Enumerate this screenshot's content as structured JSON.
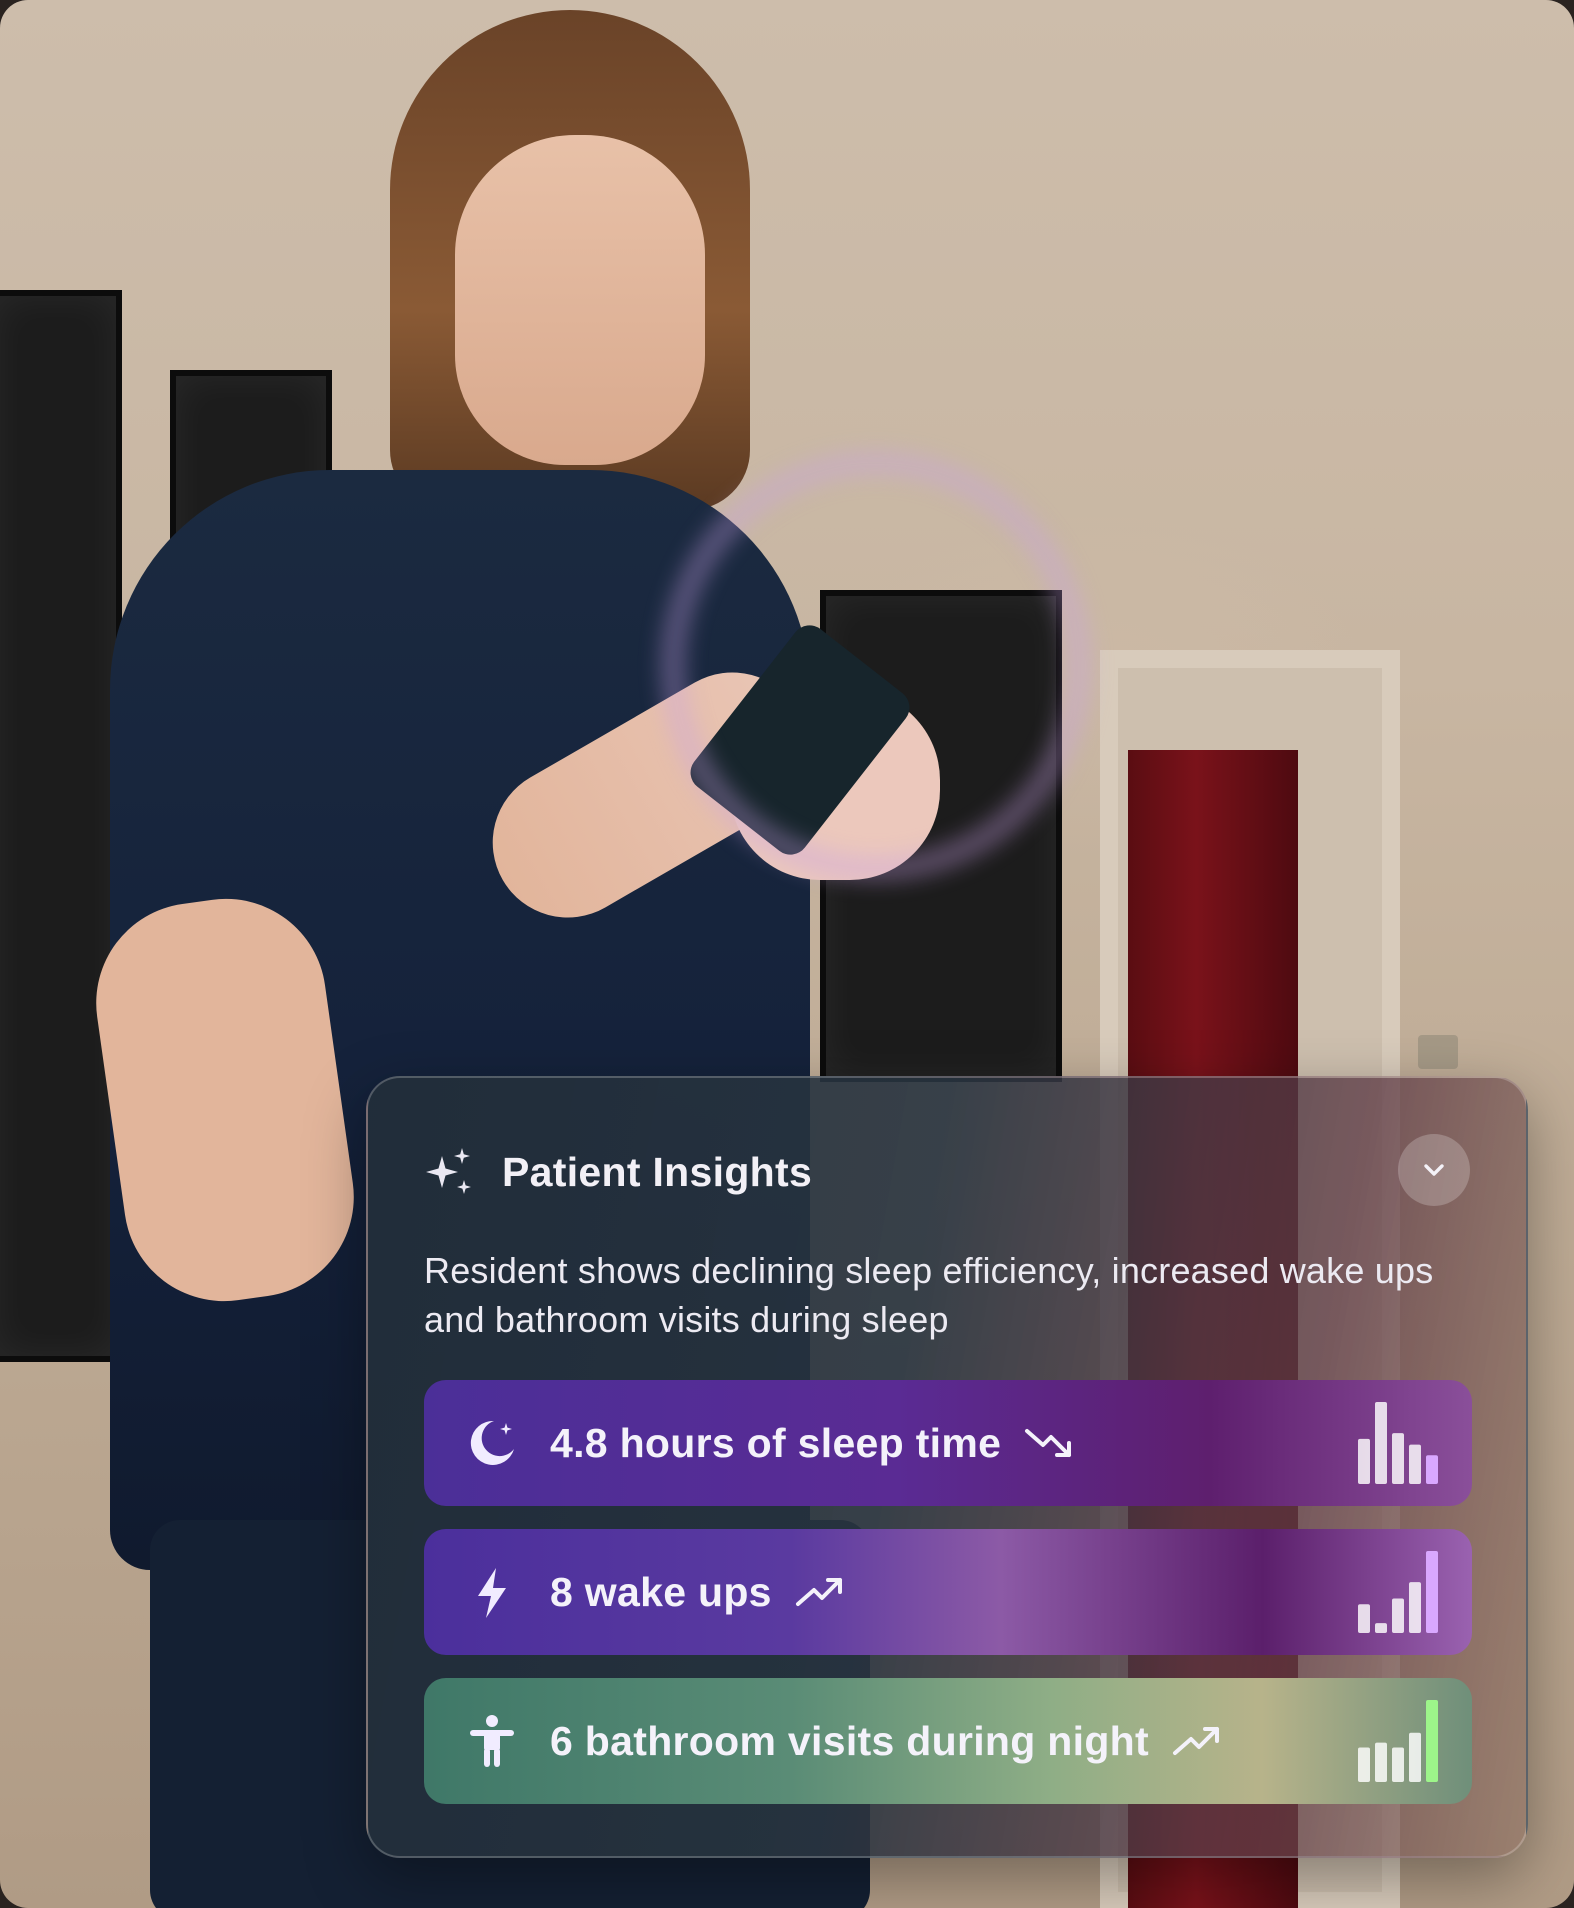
{
  "card": {
    "title": "Patient Insights",
    "title_icon": "sparkle-icon",
    "collapse_icon": "chevron-down-icon",
    "summary": "Resident shows declining sleep efficiency, increased wake ups and bathroom visits during sleep"
  },
  "metrics": [
    {
      "label": "4.8 hours of sleep time",
      "icon": "moon-icon",
      "trend": "down",
      "trend_icon": "trend-down-icon",
      "bars": [
        0.55,
        1.0,
        0.62,
        0.48,
        0.35
      ],
      "highlight_color": "#d9a8ff"
    },
    {
      "label": "8 wake ups",
      "icon": "lightning-icon",
      "trend": "up",
      "trend_icon": "trend-up-icon",
      "bars": [
        0.35,
        0.12,
        0.42,
        0.62,
        1.0
      ],
      "highlight_color": "#d9a8ff"
    },
    {
      "label": "6 bathroom visits during night",
      "icon": "person-icon",
      "trend": "up",
      "trend_icon": "trend-up-icon",
      "bars": [
        0.42,
        0.48,
        0.42,
        0.6,
        1.0
      ],
      "highlight_color": "#9df58a"
    }
  ]
}
